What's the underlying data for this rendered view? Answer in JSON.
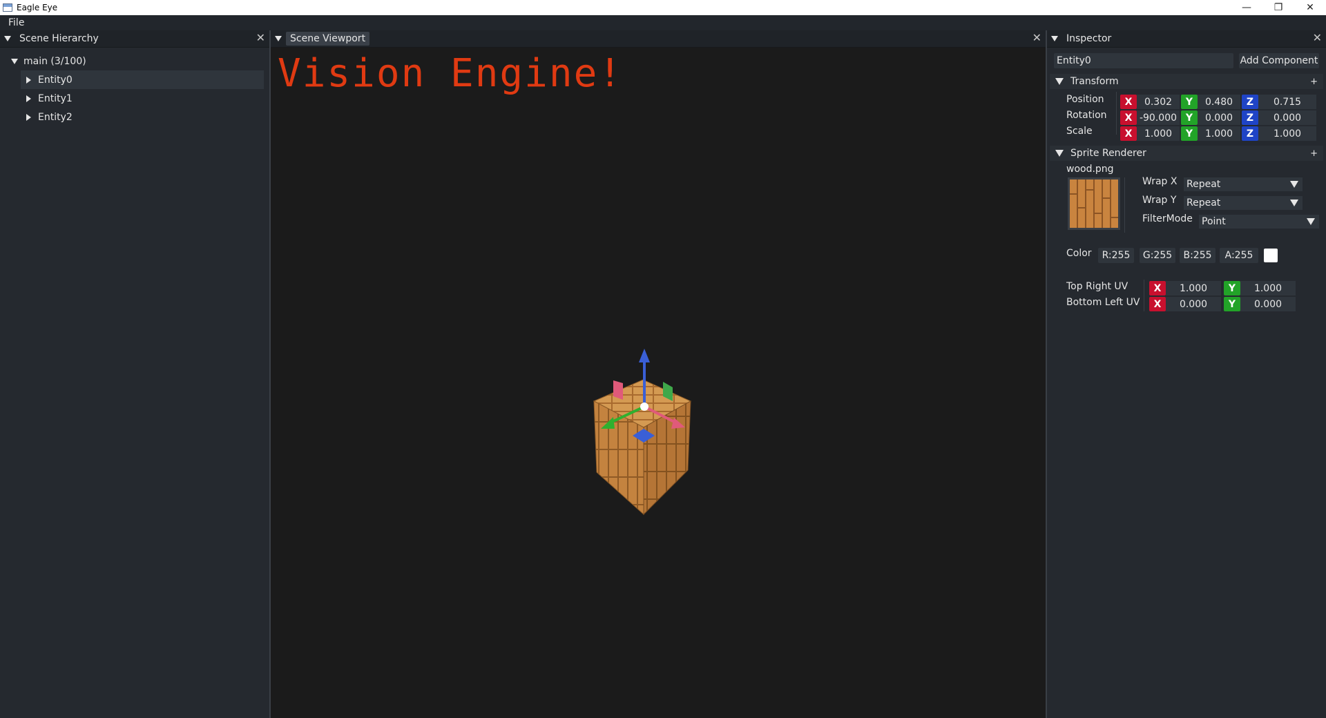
{
  "window": {
    "title": "Eagle Eye",
    "controls": [
      "—",
      "❐",
      "✕"
    ]
  },
  "menu": {
    "file": "File"
  },
  "hierarchy": {
    "tab": "Scene Hierarchy",
    "close": "✕",
    "root": "main (3/100)",
    "entities": [
      "Entity0",
      "Entity1",
      "Entity2"
    ]
  },
  "viewport": {
    "tab": "Scene Viewport",
    "close": "✕",
    "overlay_text": "Vision Engine!"
  },
  "inspector": {
    "tab": "Inspector",
    "close": "✕",
    "entity_name": "Entity0",
    "add_component": "Add Component",
    "transform": {
      "title": "Transform",
      "plus": "+",
      "position_label": "Position",
      "rotation_label": "Rotation",
      "scale_label": "Scale",
      "position": [
        "0.302",
        "0.480",
        "0.715"
      ],
      "rotation": [
        "-90.000",
        "0.000",
        "0.000"
      ],
      "scale": [
        "1.000",
        "1.000",
        "1.000"
      ]
    },
    "axes": {
      "x": "X",
      "y": "Y",
      "z": "Z"
    },
    "sprite_renderer": {
      "title": "Sprite Renderer",
      "plus": "+",
      "texture": "wood.png",
      "wrap_x_label": "Wrap X",
      "wrap_x": "Repeat",
      "wrap_y_label": "Wrap Y",
      "wrap_y": "Repeat",
      "filter_label": "FilterMode",
      "filter": "Point",
      "color_label": "Color",
      "r": "R:255",
      "g": "G:255",
      "b": "B:255",
      "a": "A:255",
      "top_right_label": "Top Right UV",
      "bottom_left_label": "Bottom Left UV",
      "top_right": [
        "1.000",
        "1.000"
      ],
      "bottom_left": [
        "0.000",
        "0.000"
      ]
    }
  },
  "colors": {
    "accent_text": "#e03a12",
    "axis_x": "#c8102e",
    "axis_y": "#22a328",
    "axis_z": "#1f44c6",
    "wood": "#c98a43"
  }
}
